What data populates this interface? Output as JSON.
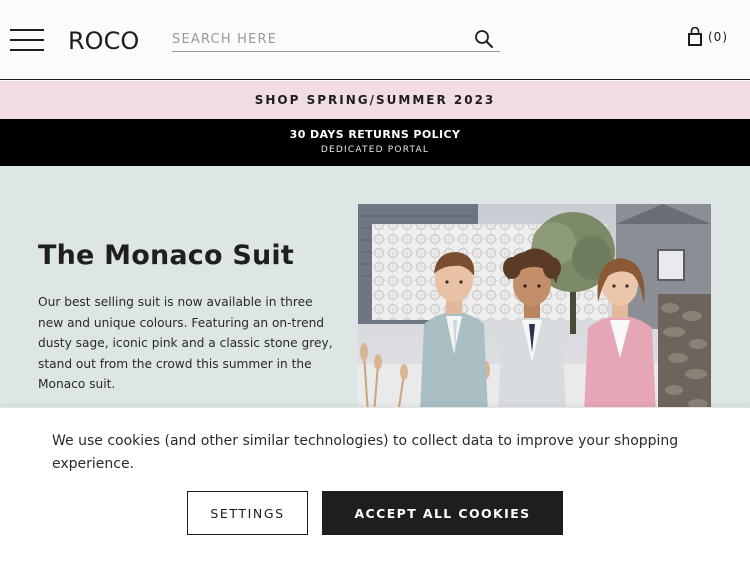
{
  "header": {
    "menu_icon": "hamburger-menu-icon",
    "logo": "ROCO",
    "search": {
      "placeholder": "SEARCH HERE",
      "value": "",
      "icon": "search-icon"
    },
    "cart": {
      "icon": "shopping-bag-icon",
      "count": "(0)"
    }
  },
  "promo": {
    "season_link": "SHOP SPRING/SUMMER 2023",
    "returns_title": "30 DAYS RETURNS POLICY",
    "returns_subtitle": "DEDICATED PORTAL"
  },
  "hero": {
    "title": "The Monaco Suit",
    "description": "Our best selling suit is now available in three new and unique colours. Featuring an on-trend dusty sage, iconic pink and a classic stone grey, stand out from the crowd this summer in the Monaco suit."
  },
  "cookie_banner": {
    "message": "We use cookies (and other similar technologies) to collect data to improve your shopping experience.",
    "settings_label": "SETTINGS",
    "accept_label": "ACCEPT ALL COOKIES"
  },
  "colors": {
    "promo_pink": "#f2dde3",
    "hero_bg": "#dde6e4",
    "suit_sage": "#a9bfc4",
    "suit_grey": "#d9dcdf",
    "suit_pink": "#e6a6b6"
  }
}
